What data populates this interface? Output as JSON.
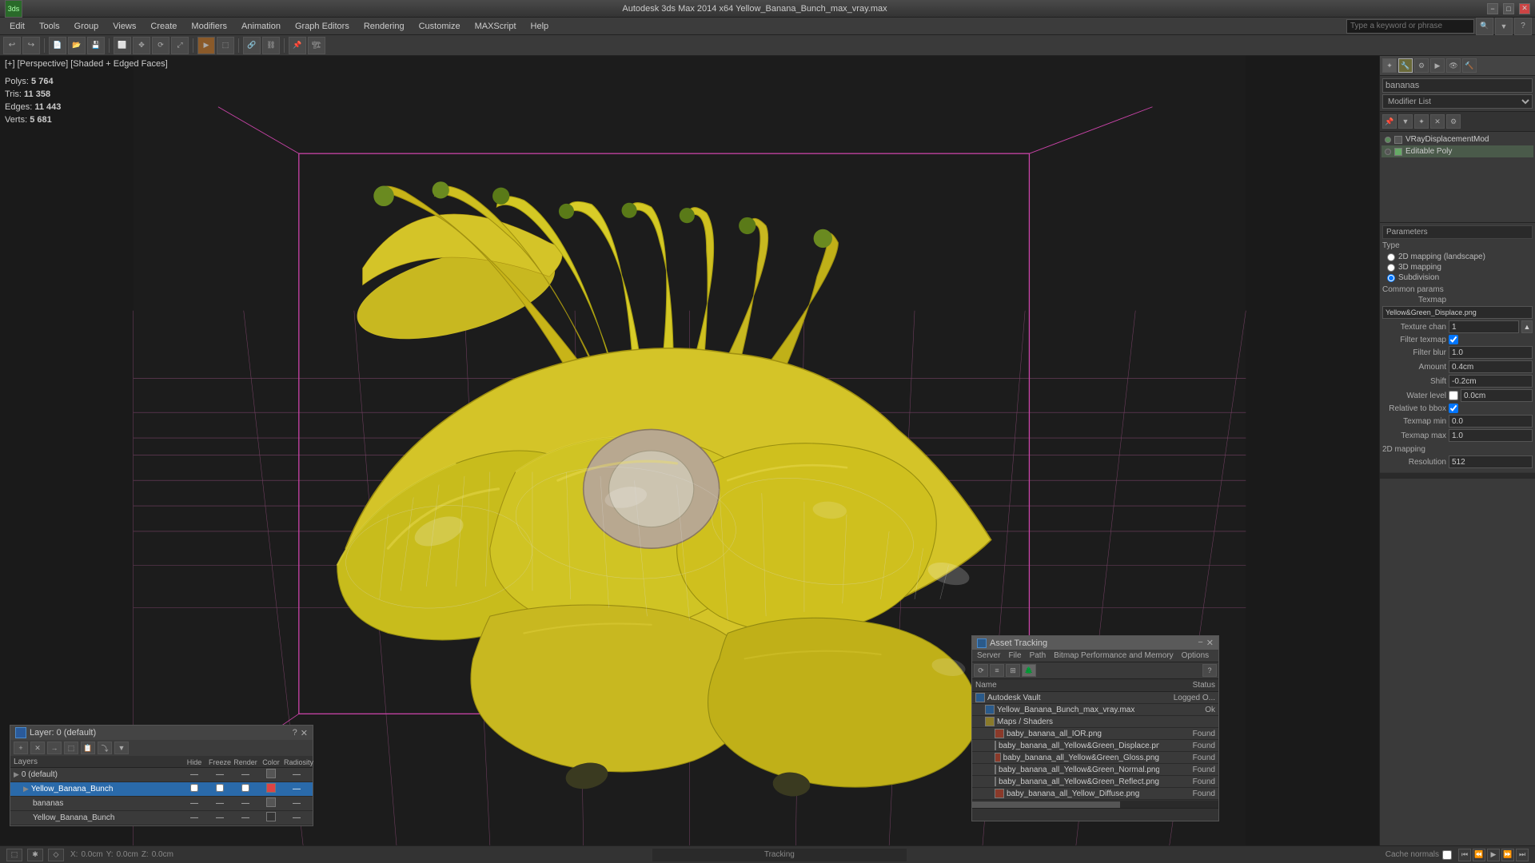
{
  "titlebar": {
    "appname": "Autodesk 3ds Max 2014 x64",
    "filename": "Yellow_Banana_Bunch_max_vray.max",
    "title": "Autodesk 3ds Max 2014 x64  Yellow_Banana_Bunch_max_vray.max",
    "minimize_label": "−",
    "maximize_label": "□",
    "close_label": "✕"
  },
  "search": {
    "placeholder": "Type a keyword or phrase"
  },
  "menubar": {
    "items": [
      "Edit",
      "Tools",
      "Group",
      "Views",
      "Create",
      "Modifiers",
      "Animation",
      "Graph Editors",
      "Rendering",
      "Customize",
      "MAXScript",
      "Help"
    ]
  },
  "toolbar": {
    "buttons": [
      "↩",
      "↪",
      "▶",
      "⬜",
      "✥",
      "⟳",
      "⤢",
      "🔍",
      "🔦",
      "⚙"
    ]
  },
  "viewport": {
    "label": "[+] [Perspective] [Shaded + Edged Faces]",
    "stats": {
      "polys_label": "Polys:",
      "polys_value": "5 764",
      "tris_label": "Tris:",
      "tris_value": "11 358",
      "edges_label": "Edges:",
      "edges_value": "11 443",
      "verts_label": "Verts:",
      "verts_value": "5 681"
    }
  },
  "right_panel": {
    "object_name": "bananas",
    "modifier_list_label": "Modifier List",
    "modifiers": [
      {
        "name": "VRayDisplacementMod",
        "active": true,
        "checked": false
      },
      {
        "name": "Editable Poly",
        "active": false,
        "checked": true
      }
    ],
    "params_header": "Parameters",
    "type_header": "Type",
    "type_options": [
      {
        "label": "2D mapping (landscape)",
        "selected": false
      },
      {
        "label": "3D mapping",
        "selected": false
      },
      {
        "label": "Subdivision",
        "selected": true
      }
    ],
    "common_params_header": "Common params",
    "texmap_label": "Texmap",
    "texmap_value": "Yellow&Green_Displace.png",
    "texture_chan_label": "Texture chan",
    "texture_chan_value": "1",
    "filter_texmap_label": "Filter texmap",
    "filter_texmap_checked": true,
    "filter_blur_label": "Filter blur",
    "filter_blur_value": "1.0",
    "amount_label": "Amount",
    "amount_value": "0.4cm",
    "shift_label": "Shift",
    "shift_value": "-0.2cm",
    "water_level_label": "Water level",
    "water_level_value": "0.0cm",
    "relative_bbox_label": "Relative to bbox",
    "relative_bbox_checked": true,
    "texmap_min_label": "Texmap min",
    "texmap_min_value": "0.0",
    "texmap_max_label": "Texmap max",
    "texmap_max_value": "1.0",
    "2d_mapping_header": "2D mapping",
    "resolution_label": "Resolution",
    "resolution_value": "512"
  },
  "layer_panel": {
    "title": "Layer: 0 (default)",
    "question": "?",
    "close": "✕",
    "columns": [
      "Layers",
      "Hide",
      "Freeze",
      "Render",
      "Color",
      "Radiosity"
    ],
    "rows": [
      {
        "name": "0 (default)",
        "indent": 0,
        "hide": false,
        "freeze": false,
        "render": false,
        "color": "#555",
        "selected": false
      },
      {
        "name": "Yellow_Banana_Bunch",
        "indent": 1,
        "hide": false,
        "freeze": false,
        "render": false,
        "color": "#dd4444",
        "selected": true
      },
      {
        "name": "bananas",
        "indent": 2,
        "hide": false,
        "freeze": false,
        "render": false,
        "color": "#555",
        "selected": false
      },
      {
        "name": "Yellow_Banana_Bunch",
        "indent": 2,
        "hide": false,
        "freeze": false,
        "render": false,
        "color": "#333",
        "selected": false
      }
    ]
  },
  "asset_panel": {
    "title": "Asset Tracking",
    "menu_items": [
      "Server",
      "File",
      "Path",
      "Bitmap Performance and Memory",
      "Options"
    ],
    "columns": [
      "Name",
      "Status"
    ],
    "rows": [
      {
        "name": "Autodesk Vault",
        "status": "Logged O...",
        "icon": "blue",
        "indent": 0
      },
      {
        "name": "Yellow_Banana_Bunch_max_vray.max",
        "status": "Ok",
        "icon": "blue",
        "indent": 1
      },
      {
        "name": "Maps / Shaders",
        "status": "",
        "icon": "yellow",
        "indent": 1
      },
      {
        "name": "baby_banana_all_IOR.png",
        "status": "Found",
        "icon": "red",
        "indent": 2
      },
      {
        "name": "baby_banana_all_Yellow&Green_Displace.png",
        "status": "Found",
        "icon": "red",
        "indent": 2
      },
      {
        "name": "baby_banana_all_Yellow&Green_Gloss.png",
        "status": "Found",
        "icon": "red",
        "indent": 2
      },
      {
        "name": "baby_banana_all_Yellow&Green_Normal.png",
        "status": "Found",
        "icon": "red",
        "indent": 2
      },
      {
        "name": "baby_banana_all_Yellow&Green_Reflect.png",
        "status": "Found",
        "icon": "red",
        "indent": 2
      },
      {
        "name": "baby_banana_all_Yellow_Diffuse.png",
        "status": "Found",
        "icon": "red",
        "indent": 2
      }
    ]
  },
  "tracking_panel": {
    "label": "Tracking"
  },
  "status_bar": {
    "cache_normals": "Cache normals"
  }
}
